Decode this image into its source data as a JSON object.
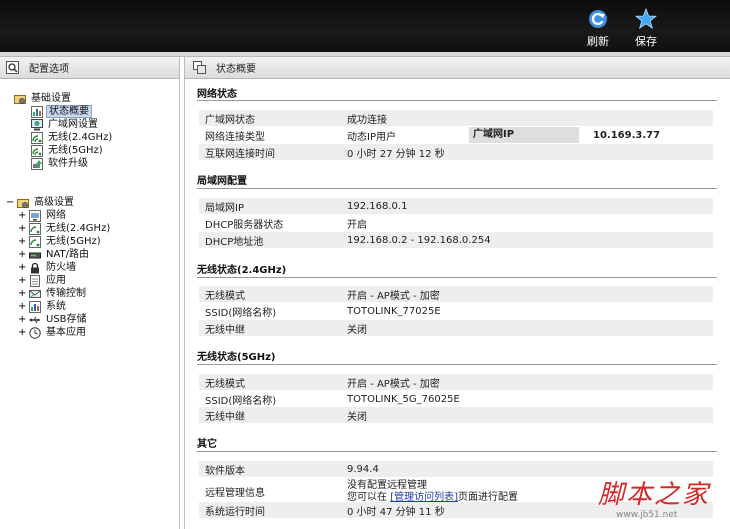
{
  "toolbar": {
    "refresh_label": "刷新",
    "save_label": "保存",
    "refresh_color": "#3b8fe0",
    "save_color": "#41a7f0"
  },
  "left_panel": {
    "title": "配置选项",
    "basic": {
      "label": "基础设置",
      "items": [
        "状态概要",
        "广域网设置",
        "无线(2.4GHz)",
        "无线(5GHz)",
        "软件升级"
      ],
      "selected": "状态概要"
    },
    "advanced": {
      "label": "高级设置",
      "items": [
        "网络",
        "无线(2.4GHz)",
        "无线(5GHz)",
        "NAT/路由",
        "防火墙",
        "应用",
        "传输控制",
        "系统",
        "USB存储",
        "基本应用"
      ]
    }
  },
  "main": {
    "title": "状态概要",
    "network_status": {
      "title": "网络状态",
      "wan_status_label": "广域网状态",
      "wan_status_value": "成功连接",
      "conn_type_label": "网络连接类型",
      "conn_type_value": "动态IP用户",
      "wan_ip_label": "广域网IP",
      "wan_ip_value": "10.169.3.77",
      "uptime_label": "互联网连接时间",
      "uptime_value": "0 小时 27 分钟 12 秒"
    },
    "lan": {
      "title": "局域网配置",
      "ip_label": "局域网IP",
      "ip_value": "192.168.0.1",
      "dhcp_label": "DHCP服务器状态",
      "dhcp_value": "开启",
      "pool_label": "DHCP地址池",
      "pool_value": "192.168.0.2 -  192.168.0.254"
    },
    "wifi24": {
      "title": "无线状态(2.4GHz)",
      "mode_label": "无线模式",
      "mode_value": "开启 - AP模式 - 加密",
      "ssid_label": "SSID(网络名称)",
      "ssid_value": "TOTOLINK_77025E",
      "relay_label": "无线中继",
      "relay_value": "关闭"
    },
    "wifi5": {
      "title": "无线状态(5GHz)",
      "mode_label": "无线模式",
      "mode_value": "开启 - AP模式 - 加密",
      "ssid_label": "SSID(网络名称)",
      "ssid_value": "TOTOLINK_5G_76025E",
      "relay_label": "无线中继",
      "relay_value": "关闭"
    },
    "other": {
      "title": "其它",
      "fw_label": "软件版本",
      "fw_value": "9.94.4",
      "remote_label": "远程管理信息",
      "remote_line1": "没有配置远程管理",
      "remote_line2_pre": "您可以在 ",
      "remote_link": "[管理访问列表]",
      "remote_line2_post": "页面进行配置",
      "sys_uptime_label": "系统运行时间",
      "sys_uptime_value": "0 小时 47 分钟 11 秒"
    }
  },
  "watermark": {
    "main": "脚本之家",
    "sub": "www.jb51.net"
  }
}
